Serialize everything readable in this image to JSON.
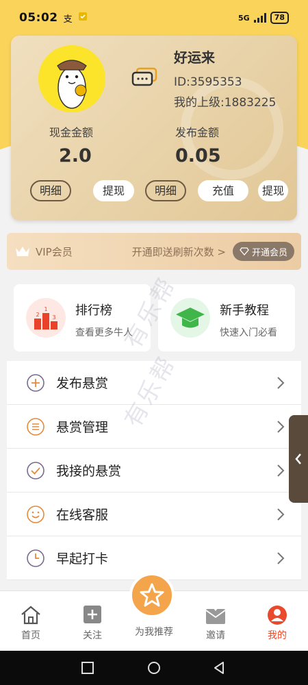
{
  "status_bar": {
    "time": "05:02",
    "network": "5G",
    "battery": "78"
  },
  "profile": {
    "username": "好运来",
    "id_text": "ID:3595353",
    "superior_text": "我的上级:1883225",
    "cash_label": "现金金额",
    "cash_value": "2.0",
    "publish_label": "发布金额",
    "publish_value": "0.05",
    "buttons": {
      "cash_detail": "明细",
      "withdraw": "提现",
      "publish_detail": "明细",
      "recharge": "充值",
      "withdraw2": "提现"
    }
  },
  "vip": {
    "label": "VIP会员",
    "promo": "开通即送刷新次数 >",
    "button": "开通会员"
  },
  "features": [
    {
      "title": "排行榜",
      "subtitle": "查看更多牛人"
    },
    {
      "title": "新手教程",
      "subtitle": "快速入门必看"
    }
  ],
  "menu": [
    {
      "label": "发布悬赏",
      "icon": "plus-circle-icon"
    },
    {
      "label": "悬赏管理",
      "icon": "list-circle-icon"
    },
    {
      "label": "我接的悬赏",
      "icon": "check-circle-icon"
    },
    {
      "label": "在线客服",
      "icon": "smile-icon"
    },
    {
      "label": "早起打卡",
      "icon": "clock-icon"
    }
  ],
  "watermark": "有乐帮",
  "tabs": [
    {
      "label": "首页",
      "icon": "home-icon"
    },
    {
      "label": "关注",
      "icon": "plus-square-icon"
    },
    {
      "label": "为我推荐",
      "icon": "star-icon"
    },
    {
      "label": "邀请",
      "icon": "envelope-icon"
    },
    {
      "label": "我的",
      "icon": "user-icon"
    }
  ],
  "colors": {
    "accent": "#fad45a",
    "active_tab": "#e84a2b",
    "center_button": "#f4a44a"
  }
}
